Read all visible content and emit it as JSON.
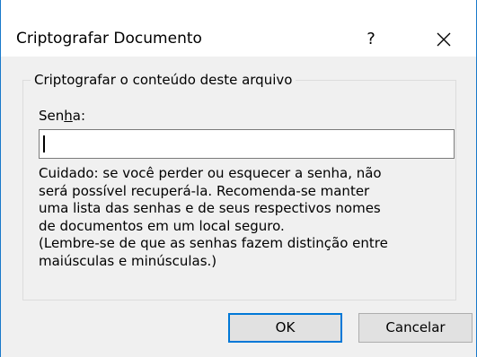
{
  "window": {
    "title": "Criptografar Documento",
    "help_label": "?",
    "close_icon": "close-icon"
  },
  "group": {
    "legend": "Criptografar o conteúdo deste arquivo"
  },
  "password": {
    "label_prefix": "Sen",
    "label_access_key": "h",
    "label_suffix": "a:",
    "value": ""
  },
  "warning": {
    "lines": [
      "Cuidado: se você perder ou esquecer a senha, não",
      "será possível recuperá-la. Recomenda-se manter",
      "uma lista das senhas e de seus respectivos nomes",
      "de documentos em um local seguro.",
      "(Lembre-se de que as senhas fazem distinção entre",
      "maiúsculas e minúsculas.)"
    ]
  },
  "buttons": {
    "ok_label": "OK",
    "cancel_label": "Cancelar"
  },
  "colors": {
    "window_border": "#1979ca",
    "focus_border": "#0078d7",
    "dialog_background": "#f0f0f0"
  }
}
